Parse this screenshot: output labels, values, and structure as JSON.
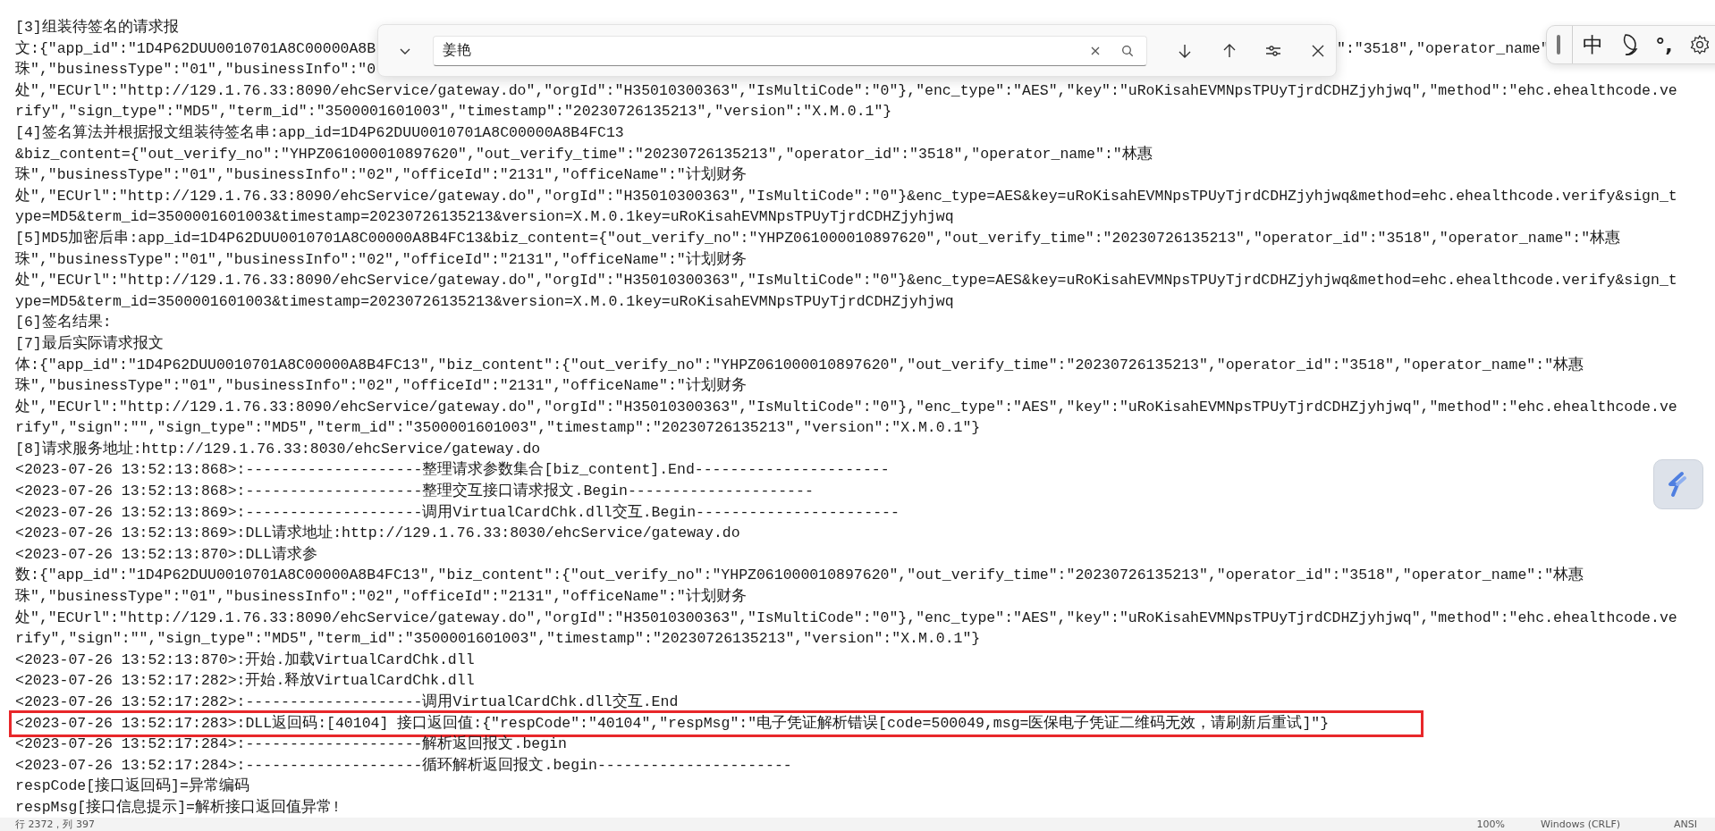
{
  "lines": [
    {
      "text": "[3]组装待签名的请求报"
    },
    {
      "text": "文:{\"app_id\":\"1D4P62DUU0010701A8C00000A8B",
      "text_right": "\":\"3518\",\"operator_name\""
    },
    {
      "text": "珠\",\"businessType\":\"01\",\"businessInfo\":\"0"
    },
    {
      "text": "处\",\"ECUrl\":\"http://129.1.76.33:8090/ehcService/gateway.do\",\"orgId\":\"H35010300363\",\"IsMultiCode\":\"0\"},\"enc_type\":\"AES\",\"key\":\"uRoKisahEVMNpsTPUyTjrdCDHZjyhjwq\",\"method\":\"ehc.ehealthcode.ve"
    },
    {
      "text": "rify\",\"sign_type\":\"MD5\",\"term_id\":\"3500001601003\",\"timestamp\":\"20230726135213\",\"version\":\"X.M.0.1\"}"
    },
    {
      "text": "[4]签名算法并根据报文组装待签名串:app_id=1D4P62DUU0010701A8C00000A8B4FC13"
    },
    {
      "text": "&biz_content={\"out_verify_no\":\"YHPZ061000010897620\",\"out_verify_time\":\"20230726135213\",\"operator_id\":\"3518\",\"operator_name\":\"林惠"
    },
    {
      "text": "珠\",\"businessType\":\"01\",\"businessInfo\":\"02\",\"officeId\":\"2131\",\"officeName\":\"计划财务"
    },
    {
      "text": "处\",\"ECUrl\":\"http://129.1.76.33:8090/ehcService/gateway.do\",\"orgId\":\"H35010300363\",\"IsMultiCode\":\"0\"}&enc_type=AES&key=uRoKisahEVMNpsTPUyTjrdCDHZjyhjwq&method=ehc.ehealthcode.verify&sign_t"
    },
    {
      "text": "ype=MD5&term_id=3500001601003&timestamp=20230726135213&version=X.M.0.1key=uRoKisahEVMNpsTPUyTjrdCDHZjyhjwq"
    },
    {
      "text": "[5]MD5加密后串:app_id=1D4P62DUU0010701A8C00000A8B4FC13&biz_content={\"out_verify_no\":\"YHPZ061000010897620\",\"out_verify_time\":\"20230726135213\",\"operator_id\":\"3518\",\"operator_name\":\"林惠"
    },
    {
      "text": "珠\",\"businessType\":\"01\",\"businessInfo\":\"02\",\"officeId\":\"2131\",\"officeName\":\"计划财务"
    },
    {
      "text": "处\",\"ECUrl\":\"http://129.1.76.33:8090/ehcService/gateway.do\",\"orgId\":\"H35010300363\",\"IsMultiCode\":\"0\"}&enc_type=AES&key=uRoKisahEVMNpsTPUyTjrdCDHZjyhjwq&method=ehc.ehealthcode.verify&sign_t"
    },
    {
      "text": "ype=MD5&term_id=3500001601003&timestamp=20230726135213&version=X.M.0.1key=uRoKisahEVMNpsTPUyTjrdCDHZjyhjwq"
    },
    {
      "text": "[6]签名结果:"
    },
    {
      "text": "[7]最后实际请求报文"
    },
    {
      "text": "体:{\"app_id\":\"1D4P62DUU0010701A8C00000A8B4FC13\",\"biz_content\":{\"out_verify_no\":\"YHPZ061000010897620\",\"out_verify_time\":\"20230726135213\",\"operator_id\":\"3518\",\"operator_name\":\"林惠"
    },
    {
      "text": "珠\",\"businessType\":\"01\",\"businessInfo\":\"02\",\"officeId\":\"2131\",\"officeName\":\"计划财务"
    },
    {
      "text": "处\",\"ECUrl\":\"http://129.1.76.33:8090/ehcService/gateway.do\",\"orgId\":\"H35010300363\",\"IsMultiCode\":\"0\"},\"enc_type\":\"AES\",\"key\":\"uRoKisahEVMNpsTPUyTjrdCDHZjyhjwq\",\"method\":\"ehc.ehealthcode.ve"
    },
    {
      "text": "rify\",\"sign\":\"\",\"sign_type\":\"MD5\",\"term_id\":\"3500001601003\",\"timestamp\":\"20230726135213\",\"version\":\"X.M.0.1\"}"
    },
    {
      "text": "[8]请求服务地址:http://129.1.76.33:8030/ehcService/gateway.do"
    },
    {
      "text": "<2023-07-26 13:52:13:868>:--------------------整理请求参数集合[biz_content].End----------------------"
    },
    {
      "text": "<2023-07-26 13:52:13:868>:--------------------整理交互接口请求报文.Begin---------------------"
    },
    {
      "text": "<2023-07-26 13:52:13:869>:--------------------调用VirtualCardChk.dll交互.Begin-----------------------"
    },
    {
      "text": "<2023-07-26 13:52:13:869>:DLL请求地址:http://129.1.76.33:8030/ehcService/gateway.do"
    },
    {
      "text": "<2023-07-26 13:52:13:870>:DLL请求参"
    },
    {
      "text": "数:{\"app_id\":\"1D4P62DUU0010701A8C00000A8B4FC13\",\"biz_content\":{\"out_verify_no\":\"YHPZ061000010897620\",\"out_verify_time\":\"20230726135213\",\"operator_id\":\"3518\",\"operator_name\":\"林惠"
    },
    {
      "text": "珠\",\"businessType\":\"01\",\"businessInfo\":\"02\",\"officeId\":\"2131\",\"officeName\":\"计划财务"
    },
    {
      "text": "处\",\"ECUrl\":\"http://129.1.76.33:8090/ehcService/gateway.do\",\"orgId\":\"H35010300363\",\"IsMultiCode\":\"0\"},\"enc_type\":\"AES\",\"key\":\"uRoKisahEVMNpsTPUyTjrdCDHZjyhjwq\",\"method\":\"ehc.ehealthcode.ve"
    },
    {
      "text": "rify\",\"sign\":\"\",\"sign_type\":\"MD5\",\"term_id\":\"3500001601003\",\"timestamp\":\"20230726135213\",\"version\":\"X.M.0.1\"}"
    },
    {
      "text": "<2023-07-26 13:52:13:870>:开始.加载VirtualCardChk.dll"
    },
    {
      "text": "<2023-07-26 13:52:17:282>:开始.释放VirtualCardChk.dll"
    },
    {
      "text": "<2023-07-26 13:52:17:282>:--------------------调用VirtualCardChk.dll交互.End"
    },
    {
      "text": "<2023-07-26 13:52:17:283>:DLL返回码:[40104] 接口返回值:{\"respCode\":\"40104\",\"respMsg\":\"电子凭证解析错误[code=500049,msg=医保电子凭证二维码无效，请刷新后重试]\"}",
      "highlighted": true
    },
    {
      "text": "<2023-07-26 13:52:17:284>:--------------------解析返回报文.begin"
    },
    {
      "text": "<2023-07-26 13:52:17:284>:--------------------循环解析返回报文.begin----------------------"
    },
    {
      "text": "respCode[接口返回码]=异常编码"
    },
    {
      "text": "respMsg[接口信息提示]=解析接口返回值异常!"
    }
  ],
  "find_bar": {
    "query": "姜艳"
  },
  "ime_toolbar": {
    "mode": "中",
    "punctuation": "°,"
  },
  "status_bar": {
    "position": "行 2372，列 397",
    "zoom": "100%",
    "line_ending": "Windows (CRLF)",
    "encoding": "ANSI"
  }
}
